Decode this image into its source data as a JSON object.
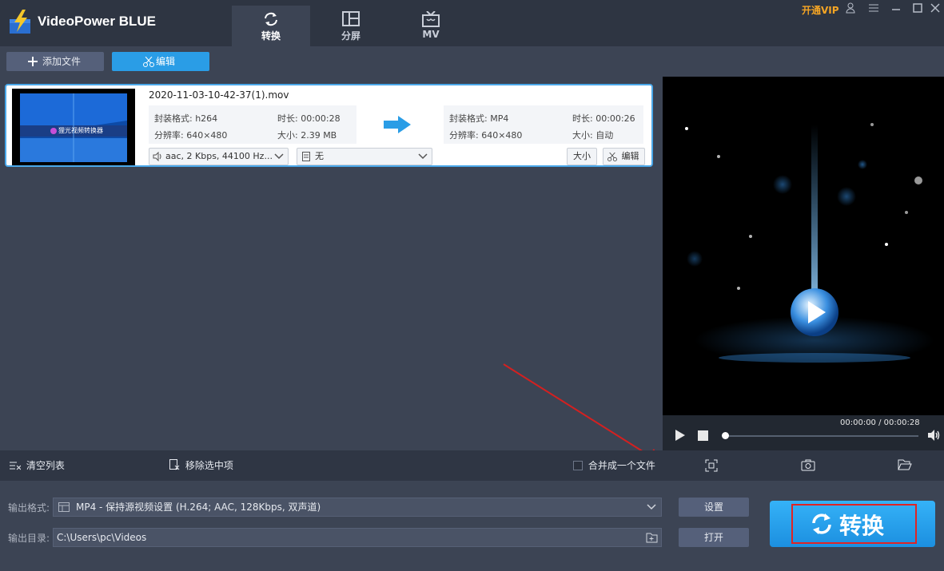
{
  "app": {
    "title": "VideoPower BLUE",
    "vip_label": "开通VIP"
  },
  "tabs": [
    {
      "label": "转换",
      "icon": "refresh-icon",
      "active": true
    },
    {
      "label": "分屏",
      "icon": "split-screen-icon",
      "active": false
    },
    {
      "label": "MV",
      "icon": "tv-icon",
      "active": false
    }
  ],
  "toolbar": {
    "add_file": "添加文件",
    "edit": "编辑"
  },
  "file": {
    "name": "2020-11-03-10-42-37(1).mov",
    "thumb_text": "狸光视频转换器",
    "source": {
      "container": "封装格式: h264",
      "duration": "时长: 00:00:28",
      "resolution": "分辨率: 640×480",
      "size": "大小: 2.39 MB"
    },
    "target": {
      "container": "封装格式: MP4",
      "duration": "时长: 00:00:26",
      "resolution": "分辨率: 640×480",
      "size": "大小: 自动"
    },
    "audio_select": "aac, 2 Kbps, 44100 Hz...",
    "subtitle_select": "无",
    "size_button": "大小",
    "edit_button": "编辑"
  },
  "player": {
    "time": "00:00:00 / 00:00:28",
    "progress": 0.0
  },
  "actions": {
    "clear_list": "清空列表",
    "remove_selected": "移除选中项",
    "merge": "合并成一个文件",
    "merge_checked": false
  },
  "output": {
    "format_label": "输出格式:",
    "format_value": "MP4 - 保持源视频设置 (H.264; AAC, 128Kbps, 双声道)",
    "dir_label": "输出目录:",
    "dir_value": "C:\\Users\\pc\\Videos",
    "settings_button": "设置",
    "open_button": "打开",
    "convert_button": "转换"
  },
  "colors": {
    "accent": "#2a9de6",
    "vip": "#f5a524",
    "highlight": "#e02424"
  }
}
